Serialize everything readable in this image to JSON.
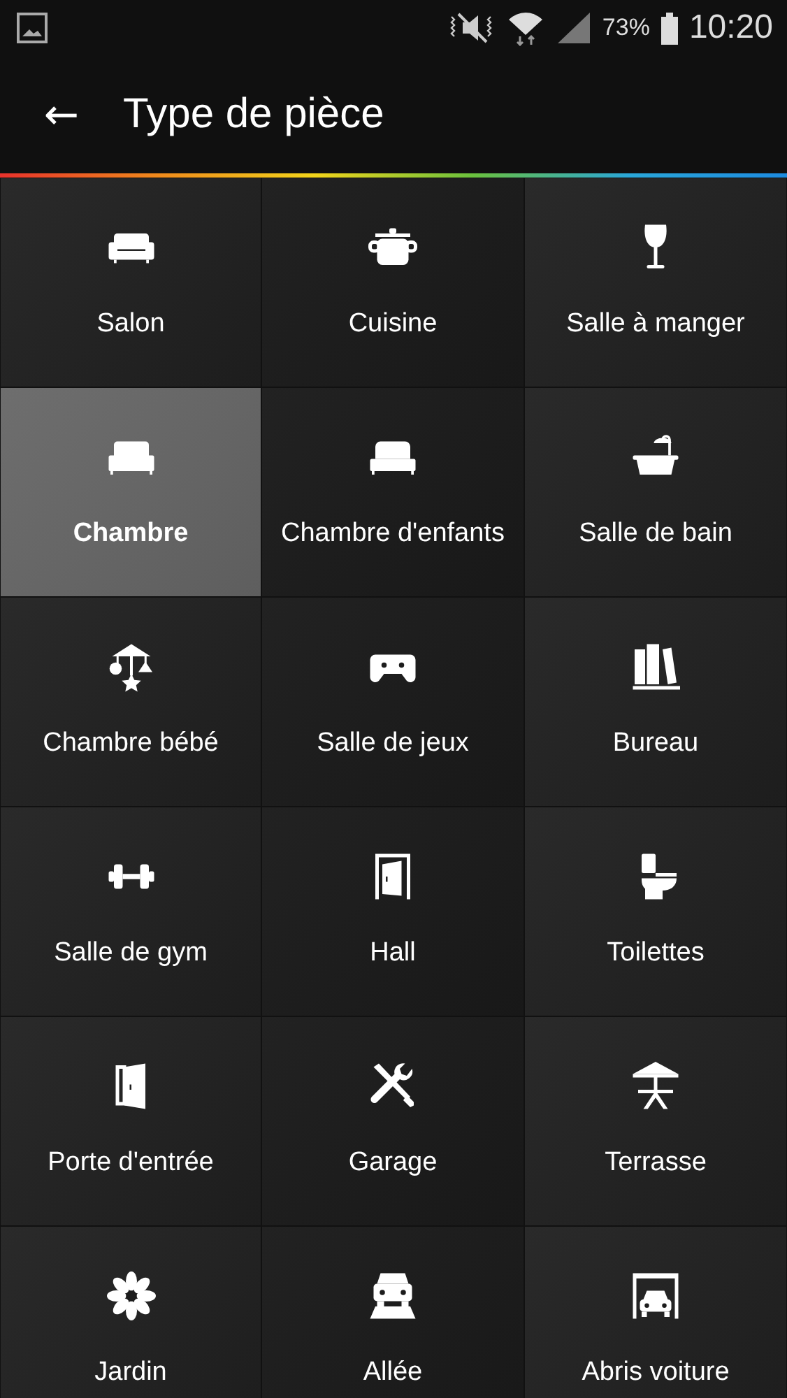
{
  "status_bar": {
    "battery": "73%",
    "time": "10:20"
  },
  "header": {
    "back": "←",
    "title": "Type de pièce"
  },
  "room_types": [
    {
      "label": "Salon",
      "kind": "sofa",
      "selected": false
    },
    {
      "label": "Cuisine",
      "kind": "pot",
      "selected": false
    },
    {
      "label": "Salle à manger",
      "kind": "wine",
      "selected": false
    },
    {
      "label": "Chambre",
      "kind": "double-bed",
      "selected": true
    },
    {
      "label": "Chambre d'enfants",
      "kind": "single-bed",
      "selected": false
    },
    {
      "label": "Salle de bain",
      "kind": "bathtub",
      "selected": false
    },
    {
      "label": "Chambre bébé",
      "kind": "mobile",
      "selected": false
    },
    {
      "label": "Salle de jeux",
      "kind": "gamepad",
      "selected": false
    },
    {
      "label": "Bureau",
      "kind": "books",
      "selected": false
    },
    {
      "label": "Salle de gym",
      "kind": "dumbbell",
      "selected": false
    },
    {
      "label": "Hall",
      "kind": "doorway",
      "selected": false
    },
    {
      "label": "Toilettes",
      "kind": "toilet",
      "selected": false
    },
    {
      "label": "Porte d'entrée",
      "kind": "door",
      "selected": false
    },
    {
      "label": "Garage",
      "kind": "tools",
      "selected": false
    },
    {
      "label": "Terrasse",
      "kind": "parasol",
      "selected": false
    },
    {
      "label": "Jardin",
      "kind": "flower",
      "selected": false
    },
    {
      "label": "Allée",
      "kind": "car-road",
      "selected": false
    },
    {
      "label": "Abris voiture",
      "kind": "carport",
      "selected": false
    }
  ]
}
